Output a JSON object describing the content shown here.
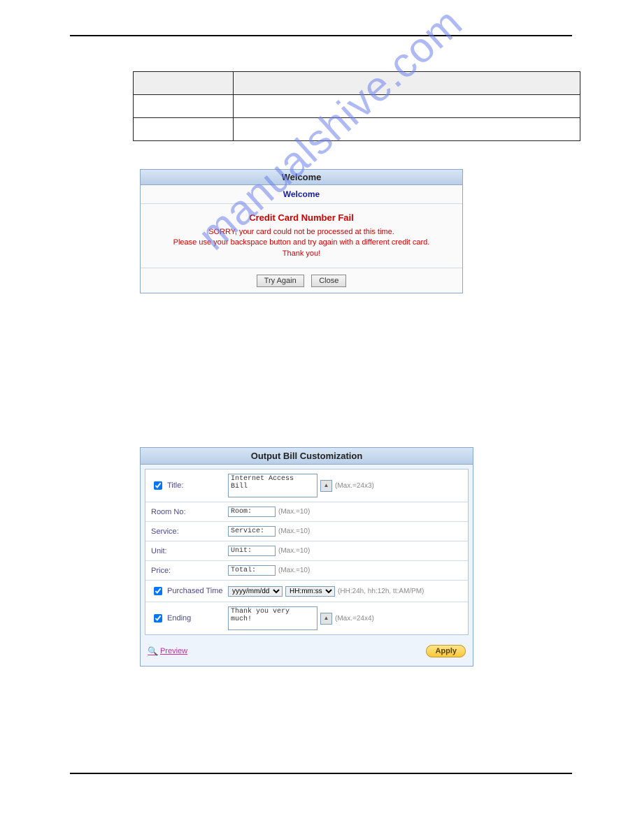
{
  "panel1": {
    "title": "Welcome",
    "welcome": "Welcome",
    "fail_heading": "Credit Card Number Fail",
    "msg_line1": "SORRY, your card could not be processed at this time.",
    "msg_line2": "Please use your backspace button and try again with a different credit card.",
    "msg_line3": "Thank you!",
    "try_again": "Try Again",
    "close": "Close"
  },
  "panel2": {
    "title": "Output Bill Customization",
    "rows": {
      "title": {
        "label": "Title:",
        "value": "Internet Access Bill",
        "hint": "(Max.=24x3)",
        "checked": true
      },
      "room": {
        "label": "Room No:",
        "value": "Room:",
        "hint": "(Max.=10)"
      },
      "service": {
        "label": "Service:",
        "value": "Service:",
        "hint": "(Max.=10)"
      },
      "unit": {
        "label": "Unit:",
        "value": "Unit:",
        "hint": "(Max.=10)"
      },
      "price": {
        "label": "Price:",
        "value": "Total:",
        "hint": "(Max.=10)"
      },
      "purchased": {
        "label": "Purchased Time",
        "date_fmt": "yyyy/mm/dd",
        "time_fmt": "HH:mm:ss",
        "hint": "(HH:24h, hh:12h, tt:AM/PM)",
        "checked": true
      },
      "ending": {
        "label": "Ending",
        "value": "Thank you very much!",
        "hint": "(Max.=24x4)",
        "checked": true
      }
    },
    "preview": "Preview",
    "apply": "Apply"
  },
  "watermark": "manualshive.com"
}
